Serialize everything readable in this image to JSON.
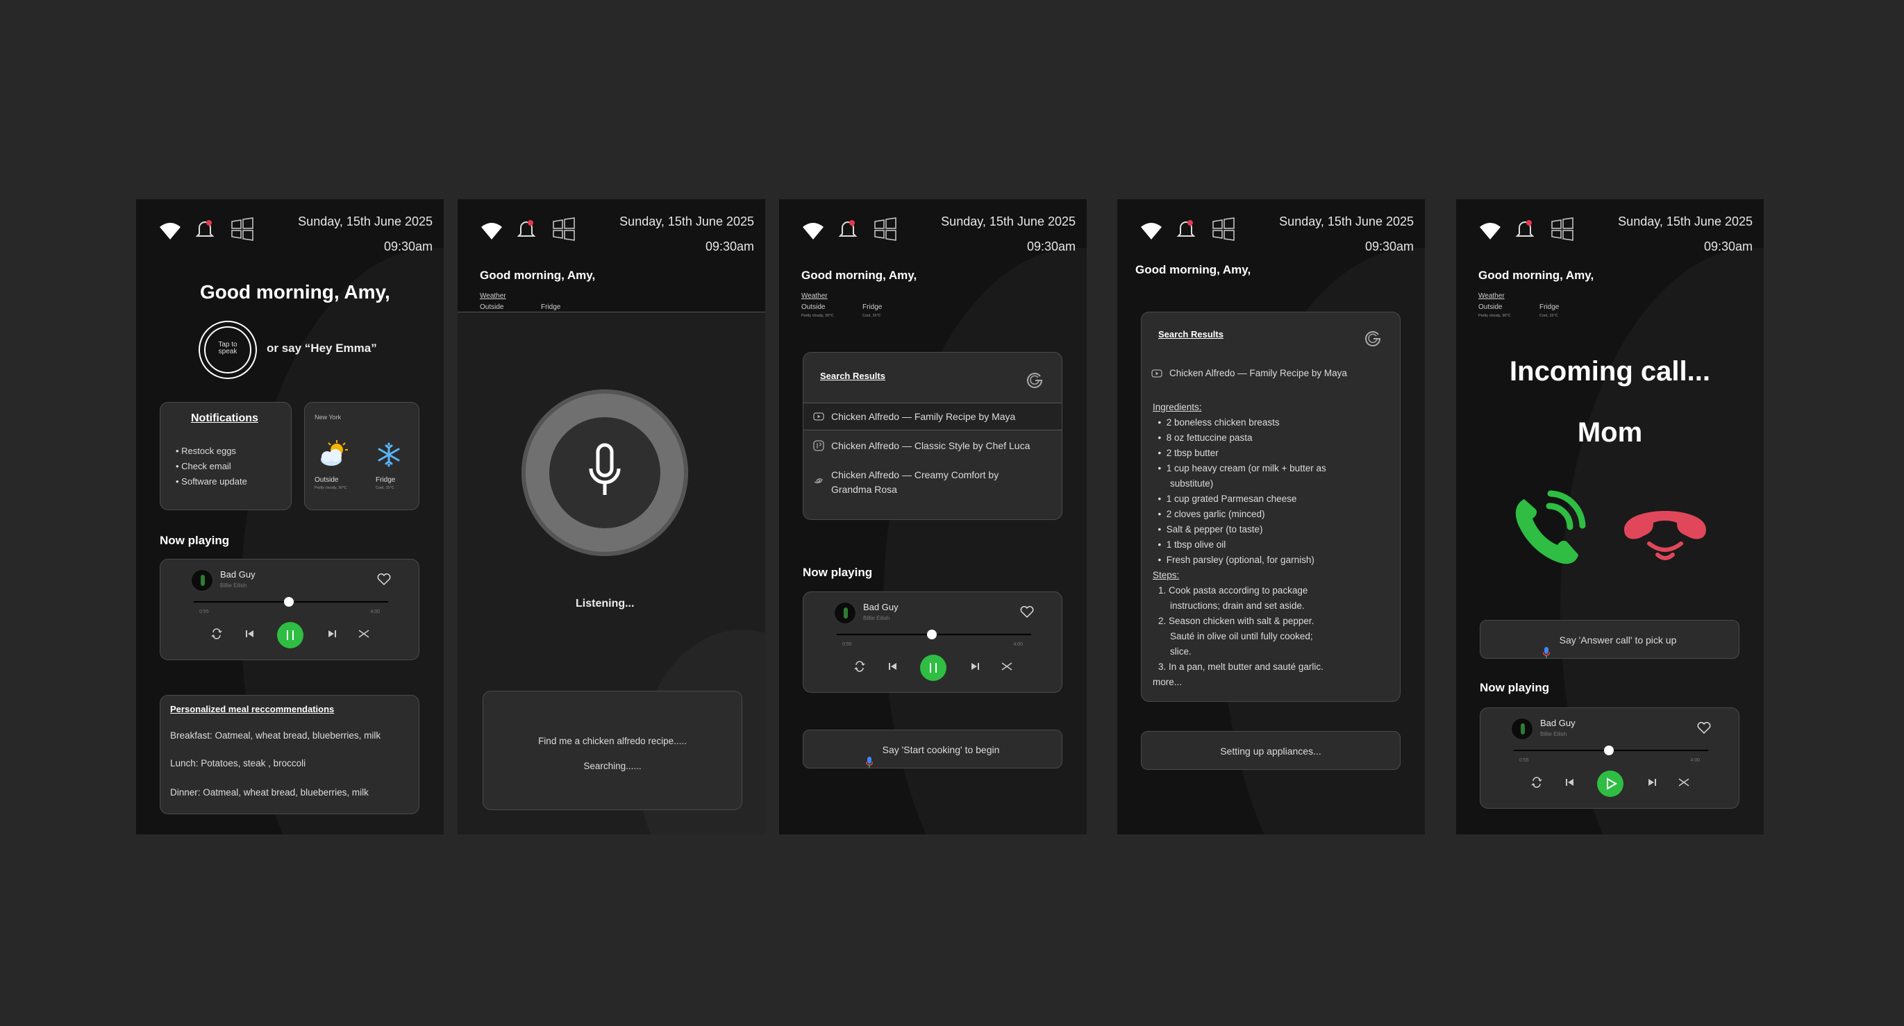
{
  "status": {
    "date": "Sunday, 15th June 2025",
    "time": "09:30am"
  },
  "greeting": "Good morning, Amy,",
  "screen1": {
    "tap_to_speak": "Tap to speak",
    "hey_emma": "or say “Hey Emma”",
    "notifications": {
      "title": "Notifications",
      "items": [
        "Restock eggs",
        "Check email",
        "Software update"
      ]
    },
    "weather": {
      "city": "New York",
      "outside": "Outside",
      "outside_sub": "Partly cloudy, 30°C",
      "fridge": "Fridge",
      "fridge_sub": "Cool, 15°C"
    },
    "meals": {
      "title": "Personalized meal reccommendations",
      "breakfast": "Breakfast: Oatmeal, wheat bread, blueberries, milk",
      "lunch": "Lunch: Potatoes, steak , broccoli",
      "dinner": "Dinner: Oatmeal, wheat bread, blueberries, milk"
    }
  },
  "mini": {
    "weather": "Weather",
    "outside": "Outside",
    "outside_sub": "Partly cloudy, 30°C",
    "fridge": "Fridge",
    "fridge_sub": "Cool, 15°C"
  },
  "now_playing": "Now playing",
  "player": {
    "song": "Bad Guy",
    "artist": "Billie Eilish",
    "elapsed": "0:55",
    "total": "4:00",
    "progress": 0.49
  },
  "screen2": {
    "listening": "Listening...",
    "query": "Find me a chicken alfredo recipe.....",
    "searching": "Searching......"
  },
  "search": {
    "title": "Search Results",
    "results": [
      "Chicken Alfredo — Family Recipe by Maya",
      "Chicken Alfredo — Classic Style by Chef Luca",
      "Chicken Alfredo — Creamy Comfort by Grandma Rosa"
    ]
  },
  "screen3": {
    "hint": "Say 'Start cooking' to begin"
  },
  "screen4": {
    "result": "Chicken Alfredo — Family Recipe by Maya",
    "ingredients_label": "Ingredients:",
    "ingredients": [
      "2 boneless chicken breasts",
      "8 oz fettuccine pasta",
      "2 tbsp butter",
      "1 cup heavy cream (or milk + butter as",
      "substitute)",
      "1 cup grated Parmesan cheese",
      "2 cloves garlic (minced)",
      "Salt & pepper (to taste)",
      "1 tbsp olive oil",
      "Fresh parsley (optional, for garnish)"
    ],
    "steps_label": "Steps:",
    "steps": [
      "1.  Cook pasta according to package",
      "instructions; drain and set aside.",
      "2.  Season chicken with salt & pepper.",
      "Sauté in olive oil until fully cooked;",
      "slice.",
      "3.  In a pan, melt butter and sauté garlic.",
      "more..."
    ],
    "status": "Setting up appliances..."
  },
  "screen5": {
    "incoming": "Incoming call...",
    "caller": "Mom",
    "hint": "Say 'Answer call' to pick up"
  },
  "colors": {
    "accent_green": "#2fbd43",
    "decline_red": "#e0475a",
    "bell_red": "#e8384f"
  }
}
